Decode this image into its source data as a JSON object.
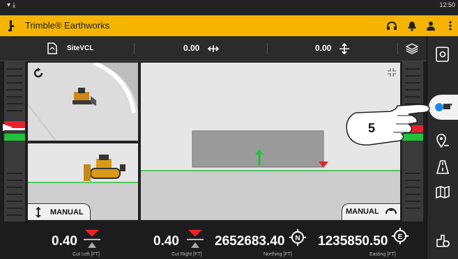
{
  "app": {
    "title": "Trimble® Earthworks",
    "clock": "12:50"
  },
  "toolbar": {
    "design_name": "SiteVCL",
    "cross_slope_value": "0.00",
    "main_slope_value": "0.00"
  },
  "views": {
    "left_mode_label": "MANUAL",
    "right_mode_label": "MANUAL"
  },
  "bottom": {
    "cut_left_value": "0.40",
    "cut_left_label": "Cut Left [FT]",
    "cut_right_value": "0.40",
    "cut_right_label": "Cut Right [FT]",
    "northing_value": "2652683.40",
    "northing_label": "Northing [FT]",
    "easting_value": "1235850.50",
    "easting_label": "Easting [FT]"
  },
  "callout": {
    "number": "5"
  },
  "colors": {
    "brand_yellow": "#f5b400",
    "cut_red": "#e8222a",
    "grade_green": "#22c23a",
    "highlight_blue": "#1e88e5"
  },
  "icons": [
    "trimble-logo-icon",
    "headset-icon",
    "bell-icon",
    "operator-icon",
    "overflow-menu-icon",
    "design-file-icon",
    "cross-slope-icon",
    "main-slope-icon",
    "layers-icon",
    "settings-list-icon",
    "machine-view-icon",
    "location-pin-icon",
    "road-view-icon",
    "map-icon",
    "machine-settings-icon",
    "reset-view-icon",
    "collapse-view-icon",
    "northing-compass-icon",
    "easting-compass-icon"
  ]
}
